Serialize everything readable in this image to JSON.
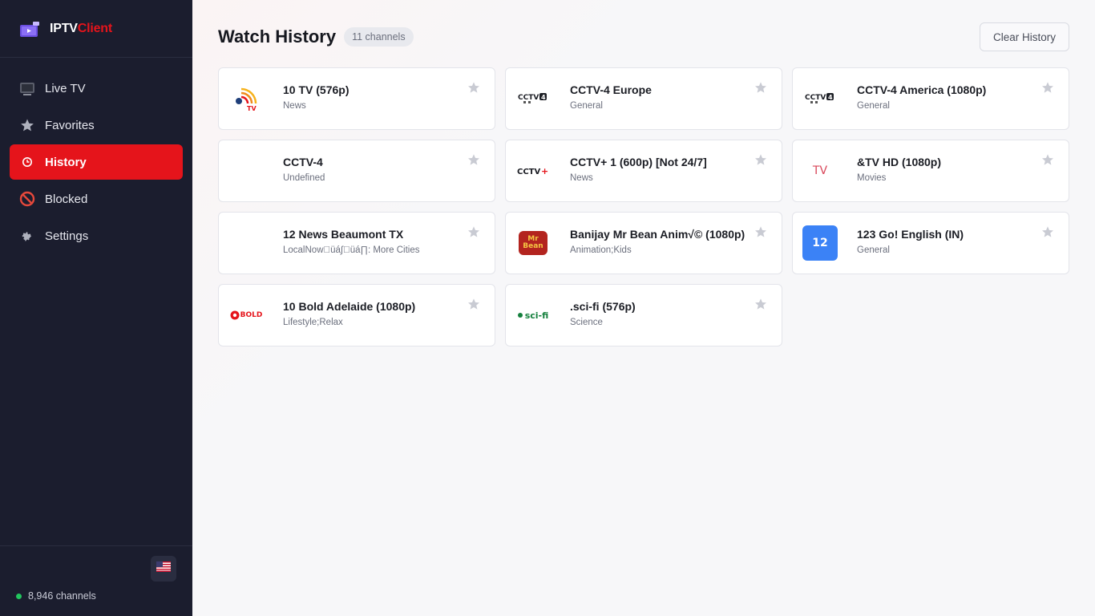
{
  "app": {
    "brand_a": "IPTV",
    "brand_b": "Client",
    "brand_color": "#e5141b"
  },
  "sidebar": {
    "items": [
      {
        "label": "Live TV",
        "icon": "tv-icon",
        "active": false
      },
      {
        "label": "Favorites",
        "icon": "star-icon",
        "active": false
      },
      {
        "label": "History",
        "icon": "clock-icon",
        "active": true
      },
      {
        "label": "Blocked",
        "icon": "blocked-icon",
        "active": false
      },
      {
        "label": "Settings",
        "icon": "gear-icon",
        "active": false
      }
    ],
    "channel_count": "8,946 channels",
    "region_flag": "flag-us-icon"
  },
  "main": {
    "title": "Watch History",
    "count_badge": "11 channels",
    "clear_label": "Clear History",
    "channels": [
      {
        "name": "10 TV (576p)",
        "category": "News",
        "logo": "10tv-logo"
      },
      {
        "name": "CCTV-4 Europe",
        "category": "General",
        "logo": "cctv4-logo"
      },
      {
        "name": "CCTV-4 America (1080p)",
        "category": "General",
        "logo": "cctv4-logo"
      },
      {
        "name": "CCTV-4",
        "category": "Undefined",
        "logo": "blank-logo"
      },
      {
        "name": "CCTV+ 1 (600p) [Not 24/7]",
        "category": "News",
        "logo": "cctvplus-logo"
      },
      {
        "name": "&TV HD (1080p)",
        "category": "Movies",
        "logo": "andtv-logo",
        "logo_text": "TV"
      },
      {
        "name": "12 News Beaumont TX",
        "category": "LocalNow\u0000üá∫\u0000üá∏: More Cities",
        "logo": "blank-logo"
      },
      {
        "name": "Banijay Mr Bean Anim√© (1080p)",
        "category": "Animation;Kids",
        "logo": "mrbean-logo",
        "logo_text": "Mr Bean"
      },
      {
        "name": "123 Go! English (IN)",
        "category": "General",
        "logo": "number-logo",
        "logo_text": "12"
      },
      {
        "name": "10 Bold Adelaide (1080p)",
        "category": "Lifestyle;Relax",
        "logo": "10bold-logo",
        "logo_text": "BOLD"
      },
      {
        "name": ".sci-fi (576p)",
        "category": "Science",
        "logo": "scifi-logo",
        "logo_text": "sci-fi"
      }
    ]
  },
  "colors": {
    "sidebar_bg": "#1b1d2e",
    "accent": "#e5141b",
    "status_online": "#22c55e",
    "number_logo_bg": "#3b82f6"
  }
}
